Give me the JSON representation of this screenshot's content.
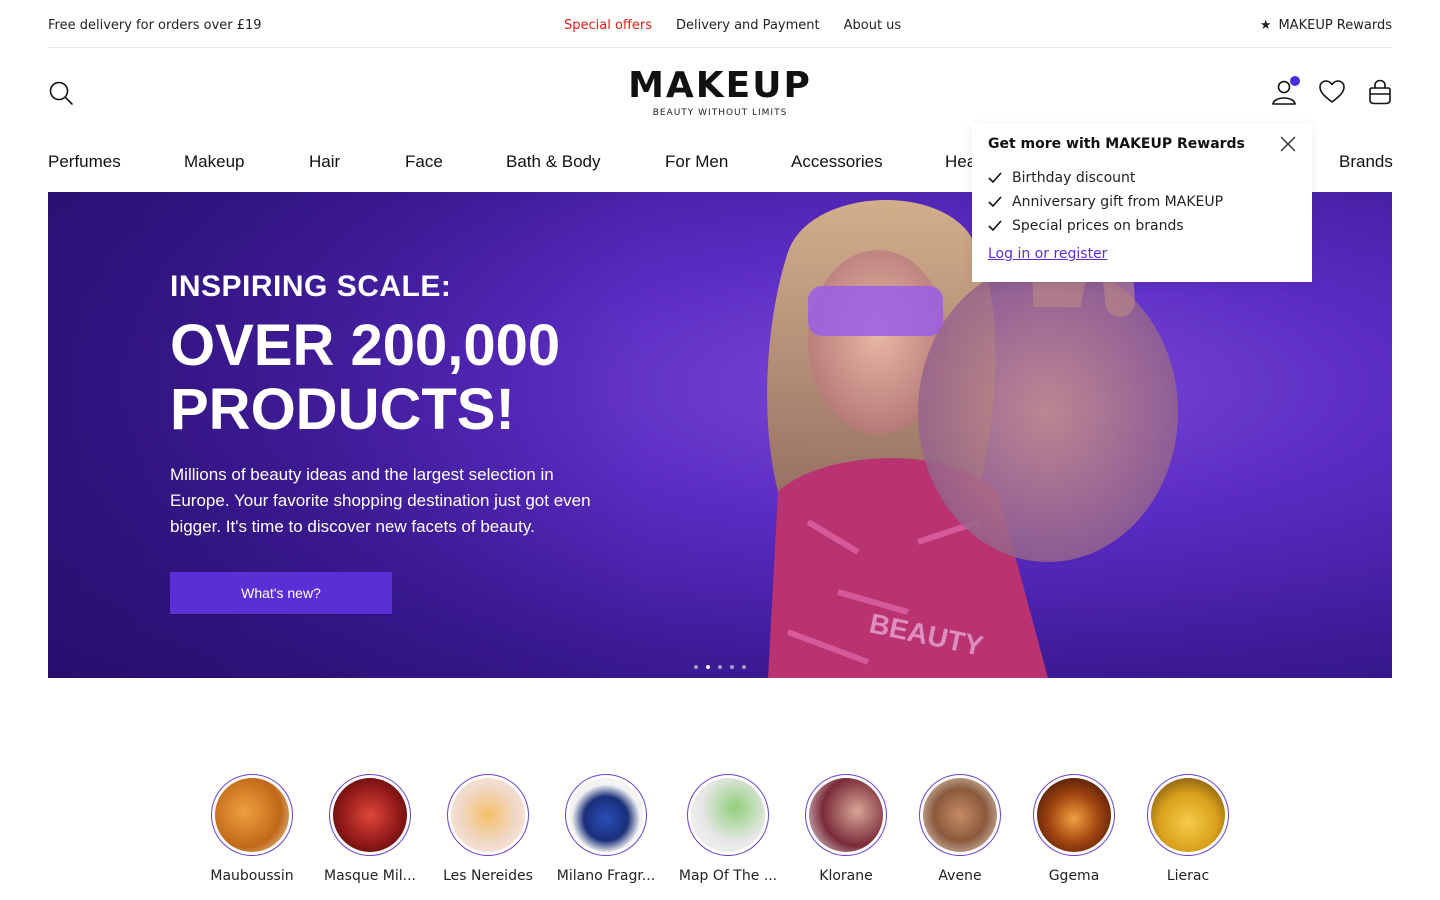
{
  "topbar": {
    "delivery_note": "Free delivery for orders over £19",
    "links": [
      "Special offers",
      "Delivery and Payment",
      "About us"
    ],
    "rewards": "MAKEUP Rewards"
  },
  "logo": {
    "wordmark": "MAKEUP",
    "tagline": "BEAUTY WITHOUT LIMITS"
  },
  "nav": {
    "items": [
      "Perfumes",
      "Makeup",
      "Hair",
      "Face",
      "Bath & Body",
      "For Men",
      "Accessories",
      "Hea",
      "Brands"
    ]
  },
  "hero": {
    "kicker": "INSPIRING SCALE:",
    "title": "OVER 200,000 PRODUCTS!",
    "description": "Millions of beauty ideas and the largest selection in Europe. Your favorite shopping destination just got even bigger. It's time to discover new facets of beauty.",
    "button": "What's new?",
    "slides": 5,
    "active_slide": 2
  },
  "rewards_popup": {
    "title": "Get more with MAKEUP Rewards",
    "benefits": [
      "Birthday discount",
      "Anniversary gift from MAKEUP",
      "Special prices on brands"
    ],
    "link": "Log in or register"
  },
  "brands": [
    "Mauboussin",
    "Masque Mil...",
    "Les Nereides",
    "Milano Fragr...",
    "Map Of The ...",
    "Klorane",
    "Avene",
    "Ggema",
    "Lierac"
  ],
  "colors": {
    "accent": "#5b2fd6",
    "offer_red": "#e0201b",
    "hero_bg": "#4a22b0",
    "user_dot": "#4a2ddb"
  },
  "icons": [
    "search-icon",
    "user-icon",
    "heart-icon",
    "bag-icon",
    "star-icon",
    "close-icon",
    "check-icon"
  ]
}
